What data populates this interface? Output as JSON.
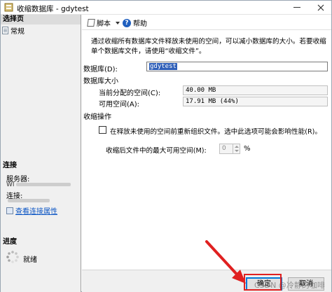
{
  "window": {
    "title": "收缩数据库 - gdytest"
  },
  "left_pane": {
    "select_page_header": "选择页",
    "pages": [
      {
        "label": "常规",
        "icon": "page-icon"
      }
    ],
    "connection_header": "连接",
    "server_label": "服务器:",
    "server_value": "WI",
    "connection_label": "连接:",
    "view_connection_link": "查看连接属性",
    "progress_header": "进度",
    "progress_status": "就绪"
  },
  "toolbar": {
    "script_label": "脚本",
    "help_label": "帮助"
  },
  "content": {
    "description": "通过收缩所有数据库文件释放未使用的空间，可以减小数据库的大小。若要收缩单个数据库文件，请使用“收缩文件”。",
    "database_label": "数据库(D):",
    "database_value": "gdytest",
    "size_group_label": "数据库大小",
    "allocated_label": "当前分配的空间(C):",
    "allocated_value": "40.00 MB",
    "available_label": "可用空间(A):",
    "available_value": "17.91 MB (44%)",
    "shrink_group_label": "收缩操作",
    "reorganize_checkbox_label": "在释放未使用的空间前重新组织文件。选中此选项可能会影响性能(R)。",
    "reorganize_checked": false,
    "max_free_label": "收缩后文件中的最大可用空间(M):",
    "max_free_value": "0",
    "max_free_unit": "%"
  },
  "buttons": {
    "ok_label": "确定",
    "cancel_label": "取消"
  },
  "watermark": "CSDN @冷静的咖啡",
  "colors": {
    "accent": "#0078d7",
    "link": "#0b55c4",
    "highlight": "#e02020",
    "selection": "#2f5fb8"
  }
}
